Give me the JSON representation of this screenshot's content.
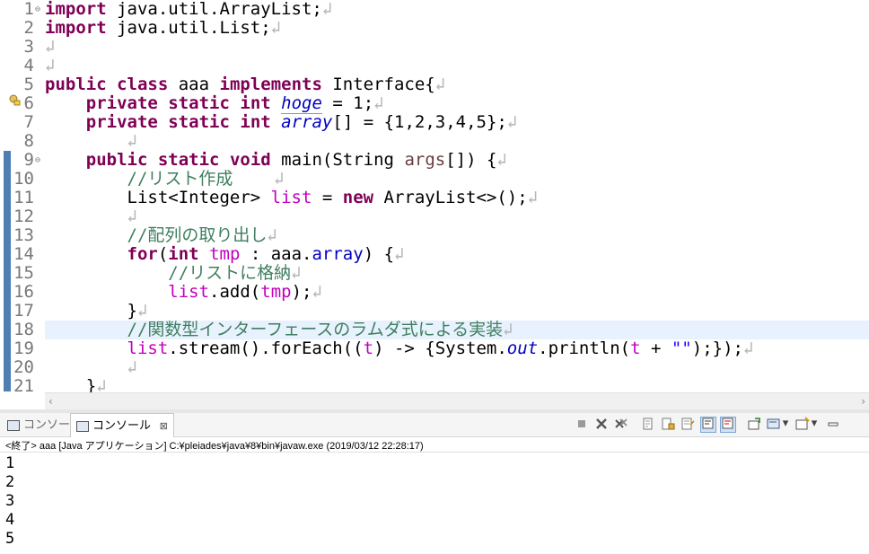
{
  "editor": {
    "line_numbers": [
      "1",
      "2",
      "3",
      "4",
      "5",
      "6",
      "7",
      "8",
      "9",
      "10",
      "11",
      "12",
      "13",
      "14",
      "15",
      "16",
      "17",
      "18",
      "19",
      "20",
      "21"
    ],
    "lines": [
      [
        "import",
        " java.util.ArrayList;"
      ],
      [
        "import",
        " java.util.List;"
      ],
      [
        ""
      ],
      [
        ""
      ],
      [
        "public",
        " ",
        "class",
        " aaa ",
        "implements",
        " Interface{"
      ],
      [
        "    ",
        "private",
        " ",
        "static",
        " ",
        "int",
        " ",
        "hoge",
        " = 1;"
      ],
      [
        "    ",
        "private",
        " ",
        "static",
        " ",
        "int",
        " ",
        "array",
        "[] = {1,2,3,4,5};"
      ],
      [
        "        "
      ],
      [
        "    ",
        "public",
        " ",
        "static",
        " ",
        "void",
        " main(String ",
        "args",
        "[]) {"
      ],
      [
        "        ",
        "//リスト作成    "
      ],
      [
        "        List<Integer> ",
        "list",
        " = ",
        "new",
        " ArrayList<>();"
      ],
      [
        "        "
      ],
      [
        "        ",
        "//配列の取り出し"
      ],
      [
        "        ",
        "for",
        "(",
        "int",
        " ",
        "tmp",
        " : aaa.",
        "array",
        ") {"
      ],
      [
        "            ",
        "//リストに格納"
      ],
      [
        "            ",
        "list",
        ".add(",
        "tmp",
        ");"
      ],
      [
        "        }"
      ],
      [
        "        ",
        "//関数型インターフェースのラムダ式による実装"
      ],
      [
        "        ",
        "list",
        ".stream().forEach((",
        "t",
        ") -> {System.",
        "out",
        ".println(",
        "t",
        " + ",
        "\"\"",
        ");});"
      ],
      [
        "        "
      ],
      [
        "    }"
      ]
    ]
  },
  "console": {
    "tabs": [
      {
        "label": "コンソール"
      },
      {
        "label": "コンソール"
      }
    ],
    "close_glyph": "⊠",
    "status_text": "<終了> aaa [Java アプリケーション] C:¥pleiades¥java¥8¥bin¥javaw.exe (2019/03/12 22:28:17)",
    "output": [
      "1",
      "2",
      "3",
      "4",
      "5"
    ]
  }
}
